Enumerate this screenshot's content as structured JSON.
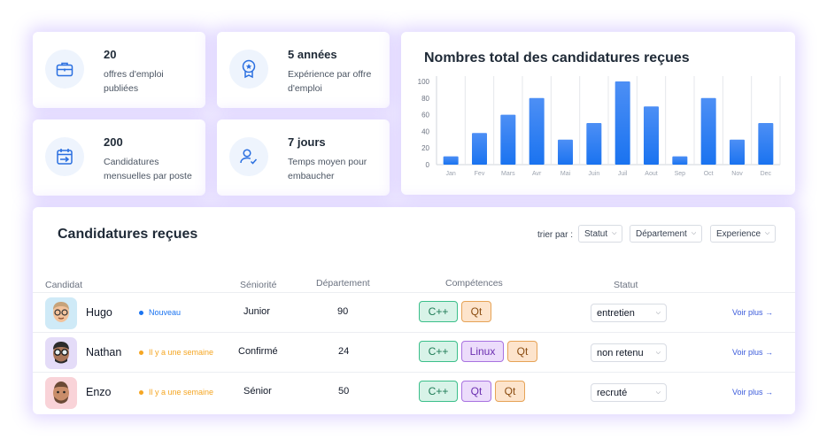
{
  "stats": [
    {
      "value": "20",
      "label": "offres d'emploi publiées",
      "icon": "briefcase-icon"
    },
    {
      "value": "5 années",
      "label": "Expérience par offre d'emploi",
      "icon": "award-icon"
    },
    {
      "value": "200",
      "label": "Candidatures mensuelles par poste",
      "icon": "calendar-arrow-icon"
    },
    {
      "value": "7 jours",
      "label": "Temps moyen pour embaucher",
      "icon": "user-check-icon"
    }
  ],
  "chart_data": {
    "type": "bar",
    "title": "Nombres total des candidatures reçues",
    "categories": [
      "Jan",
      "Fev",
      "Mars",
      "Avr",
      "Mai",
      "Juin",
      "Juil",
      "Aout",
      "Sep",
      "Oct",
      "Nov",
      "Dec"
    ],
    "values": [
      10,
      38,
      60,
      80,
      30,
      50,
      100,
      70,
      10,
      80,
      30,
      50
    ],
    "ylim": [
      0,
      100
    ],
    "yticks": [
      0,
      20,
      40,
      60,
      80,
      100
    ],
    "grid": true,
    "bar_color": "#1a73f0"
  },
  "applications": {
    "title": "Candidatures reçues",
    "sort_label": "trier par :",
    "sort_options": [
      "Statut",
      "Département",
      "Experience"
    ],
    "headers": {
      "candidate": "Candidat",
      "seniority": "Séniorité",
      "department": "Département",
      "skills": "Compétences",
      "status": "Statut"
    },
    "rows": [
      {
        "name": "Hugo",
        "badge": "Nouveau",
        "badge_color": "#1a73f0",
        "seniority": "Junior",
        "department": "90",
        "skills": [
          "C++",
          "Qt"
        ],
        "status": "entretien",
        "link": "Voir plus →",
        "avatar_bg": "#cfeaf7"
      },
      {
        "name": "Nathan",
        "badge": "Il y a une semaine",
        "badge_color": "#f5a623",
        "seniority": "Confirmé",
        "department": "24",
        "skills": [
          "C++",
          "Linux",
          "Qt"
        ],
        "status": "non retenu",
        "link": "Voir plus →",
        "avatar_bg": "#e4dcf8"
      },
      {
        "name": "Enzo",
        "badge": "Il y a une semaine",
        "badge_color": "#f5a623",
        "seniority": "Sénior",
        "department": "50",
        "skills": [
          "C++",
          "Qt",
          "Qt"
        ],
        "status": "recruté",
        "link": "Voir plus →",
        "avatar_bg": "#f9d3d8"
      }
    ]
  }
}
